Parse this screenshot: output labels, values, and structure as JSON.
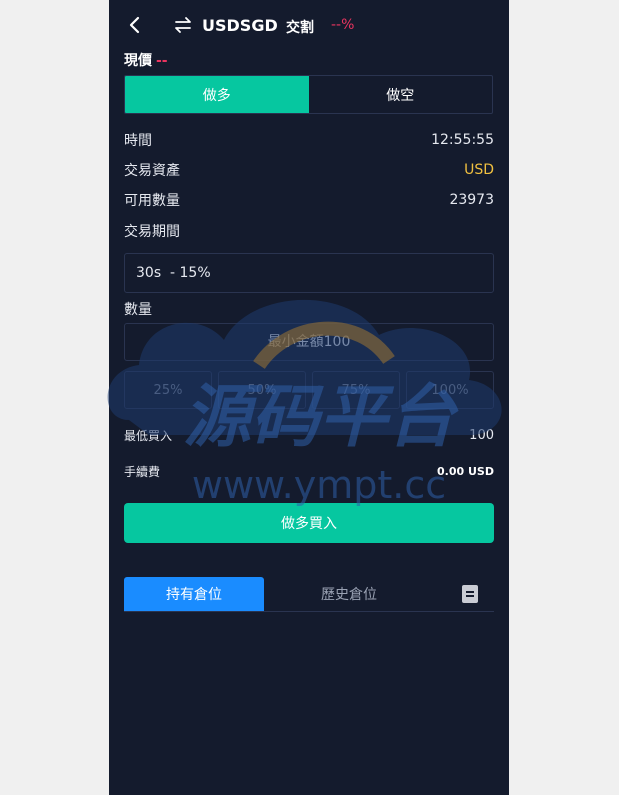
{
  "header": {
    "symbol": "USDSGD",
    "trade_label": "交割",
    "change": "--%"
  },
  "price": {
    "label": "現價",
    "value": "--"
  },
  "direction_tabs": [
    {
      "label": "做多",
      "active": true
    },
    {
      "label": "做空",
      "active": false
    }
  ],
  "info": {
    "time_label": "時間",
    "time_value": "12:55:55",
    "asset_label": "交易資產",
    "asset_value": "USD",
    "available_label": "可用數量",
    "available_value": "23973",
    "period_label": "交易期間"
  },
  "period": {
    "selected": "30s  - 15%"
  },
  "amount": {
    "label": "數量",
    "placeholder": "最小金額100"
  },
  "percent_options": [
    "25%",
    "50%",
    "75%",
    "100%"
  ],
  "min_buy": {
    "label": "最低買入",
    "value": "100"
  },
  "fee": {
    "label": "手續費",
    "value": "0.00 USD"
  },
  "buy_button_label": "做多買入",
  "position_tabs": {
    "holding": "持有倉位",
    "history": "歷史倉位"
  },
  "watermark": {
    "cn": "源码平台",
    "url": "www.ympt.cc"
  },
  "colors": {
    "background": "#141b2d",
    "accent_green": "#06c7a0",
    "accent_blue": "#1a8cff",
    "negative": "#e8345f",
    "usd_yellow": "#f0c040"
  }
}
